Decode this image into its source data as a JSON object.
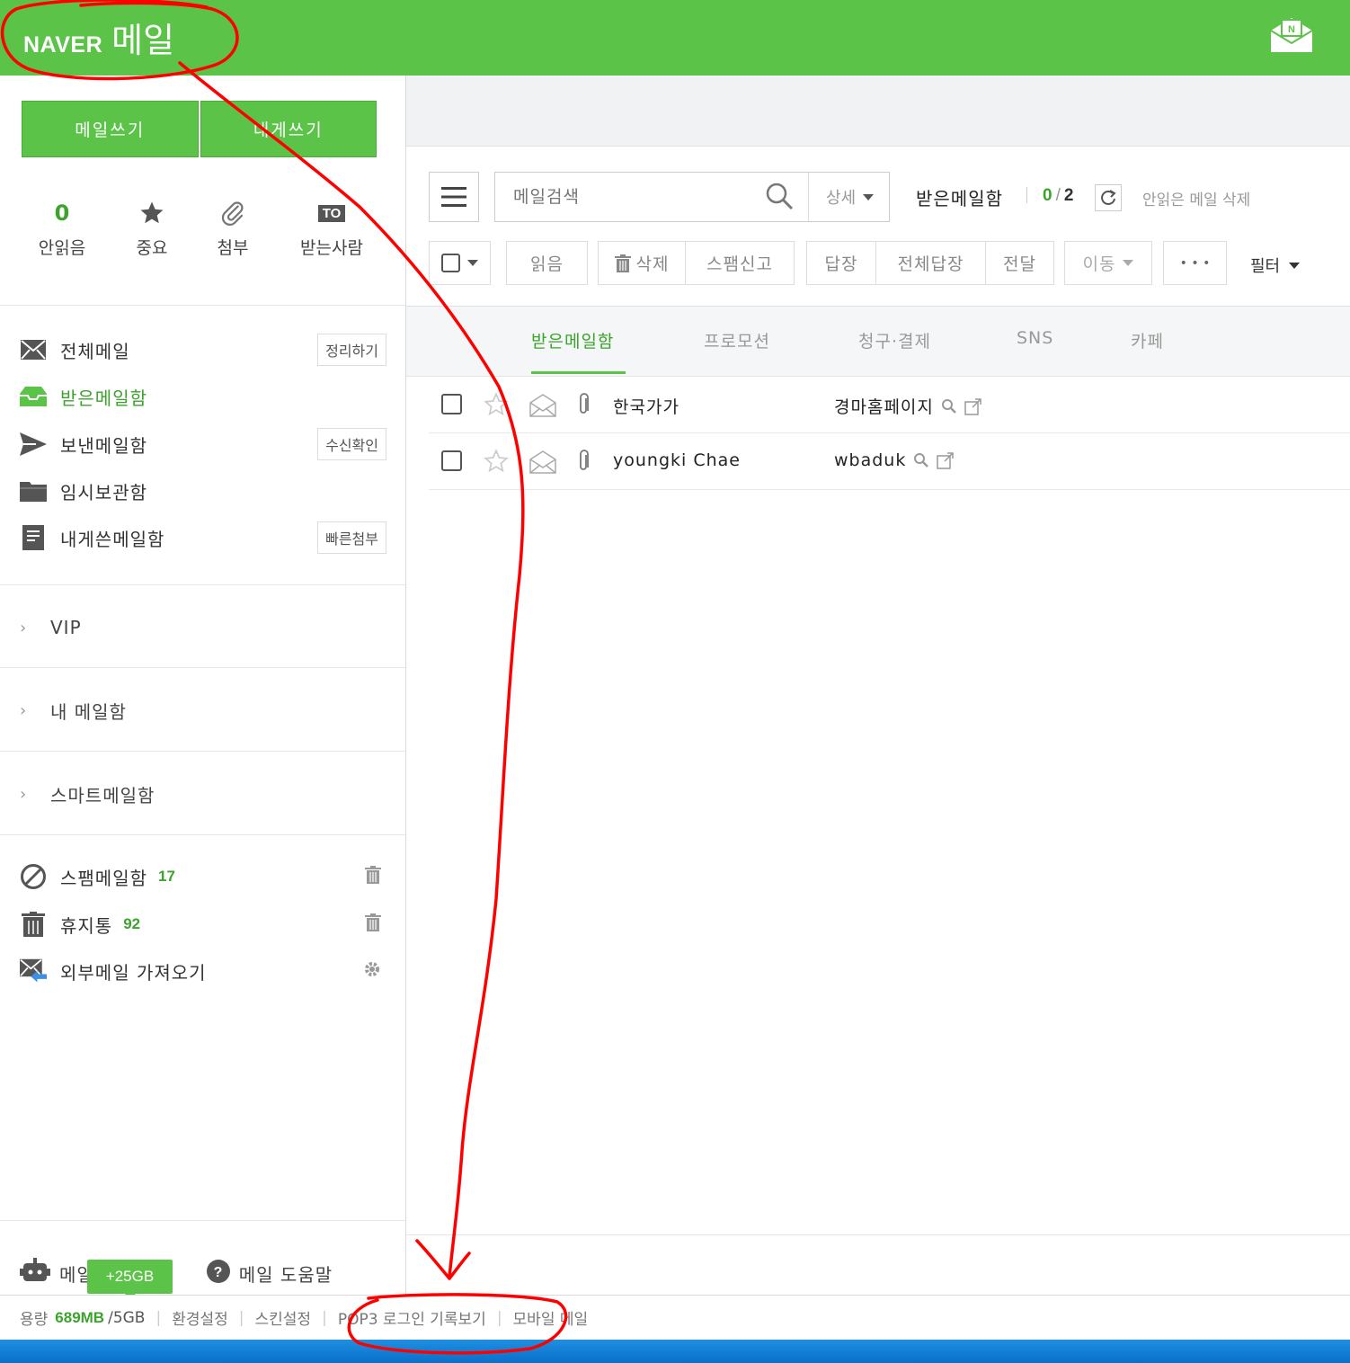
{
  "header": {
    "brand": "NAVER",
    "product": "메일",
    "icon": "naver-mail-envelope-icon"
  },
  "sidebar": {
    "compose": {
      "write_mail": "메일쓰기",
      "write_to_me": "내게쓰기"
    },
    "quick": {
      "unread_count": "0",
      "unread_label": "안읽음",
      "important_label": "중요",
      "attachment_label": "첨부",
      "to_badge": "TO",
      "to_label": "받는사람"
    },
    "folders": [
      {
        "label": "전체메일",
        "action": "정리하기",
        "icon": "envelope-x-icon"
      },
      {
        "label": "받은메일함",
        "icon": "inbox-icon",
        "active": true
      },
      {
        "label": "보낸메일함",
        "action": "수신확인",
        "icon": "send-icon"
      },
      {
        "label": "임시보관함",
        "icon": "folder-icon"
      },
      {
        "label": "내게쓴메일함",
        "action": "빠른첨부",
        "icon": "note-icon"
      }
    ],
    "groups": [
      {
        "label": "VIP"
      },
      {
        "label": "내 메일함"
      },
      {
        "label": "스마트메일함"
      }
    ],
    "special": [
      {
        "label": "스팸메일함",
        "count": "17",
        "icon": "block-icon"
      },
      {
        "label": "휴지통",
        "count": "92",
        "icon": "trash-icon"
      },
      {
        "label": "외부메일 가져오기",
        "icon": "import-mail-icon"
      }
    ],
    "bottom": {
      "smart_bot": "메일 스마트봇",
      "help": "메일 도움말",
      "storage_badge": "+25GB"
    }
  },
  "footer": {
    "usage_label": "용량",
    "usage_value": "689MB",
    "usage_total": "/5GB",
    "settings": "환경설정",
    "skin": "스킨설정",
    "pop3_log": "POP3 로그인 기록보기",
    "mobile": "모바일 메일"
  },
  "search": {
    "placeholder": "메일검색",
    "detail": "상세"
  },
  "mailbox": {
    "title": "받은메일함",
    "unread": "0",
    "total": "2",
    "delete_unread": "안읽은 메일 삭제"
  },
  "toolbar": {
    "read": "읽음",
    "delete": "삭제",
    "spam": "스팸신고",
    "reply": "답장",
    "reply_all": "전체답장",
    "forward": "전달",
    "move": "이동",
    "more": "• • •",
    "filter": "필터"
  },
  "tabs": [
    "받은메일함",
    "프로모션",
    "청구·결제",
    "SNS",
    "카페"
  ],
  "mails": [
    {
      "sender": "한국가가",
      "subject": "경마홈페이지"
    },
    {
      "sender": "youngki Chae",
      "subject": "wbaduk"
    }
  ],
  "colors": {
    "brand": "#5bc348",
    "accent_text": "#3ca32c",
    "annotation": "#ff0000"
  }
}
